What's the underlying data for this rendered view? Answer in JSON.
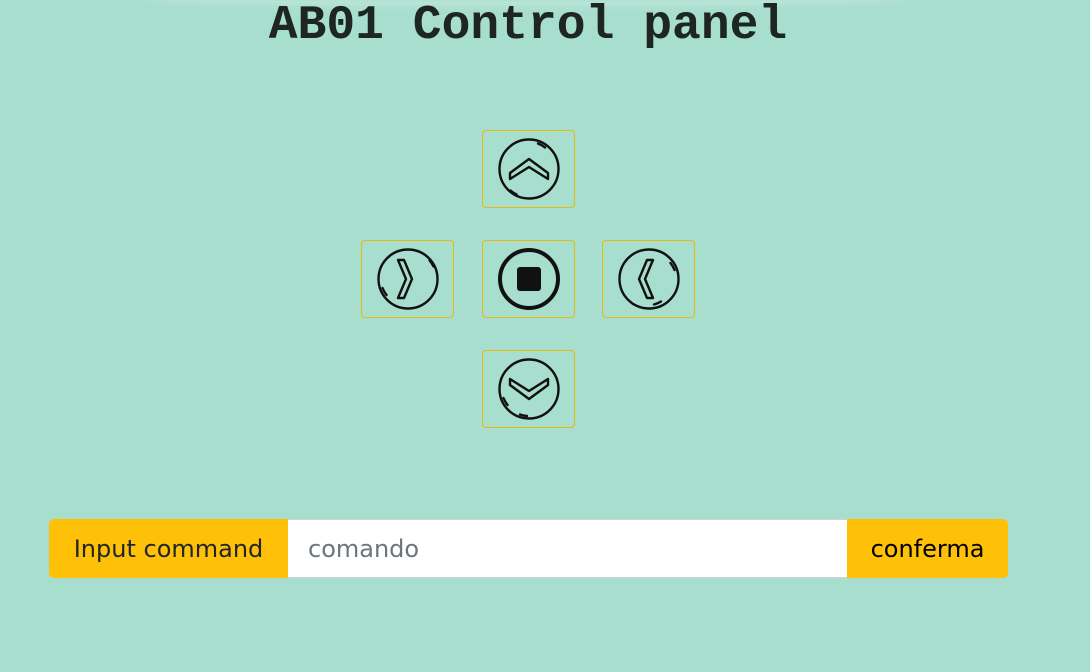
{
  "header": {
    "title": "AB01 Control panel"
  },
  "controls": {
    "up": {
      "icon": "chevron-up-circle-icon"
    },
    "left": {
      "icon": "chevron-left-circle-icon"
    },
    "stop": {
      "icon": "stop-circle-icon"
    },
    "right": {
      "icon": "chevron-right-circle-icon"
    },
    "down": {
      "icon": "chevron-down-circle-icon"
    }
  },
  "command": {
    "label": "Input command",
    "placeholder": "comando",
    "value": "",
    "confirm_label": "conferma"
  },
  "colors": {
    "background": "#a8dece",
    "accent": "#ffc107",
    "button_border": "#e7b90e",
    "title_text": "#1e2622"
  }
}
